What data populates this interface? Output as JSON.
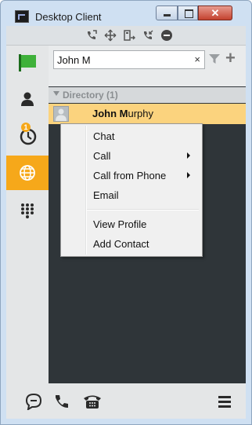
{
  "window": {
    "title": "Desktop Client"
  },
  "toolbar": {
    "icons": [
      "call-forward-icon",
      "move-icon",
      "transfer-icon",
      "call-return-icon",
      "minus-circle-icon"
    ]
  },
  "sidebar": {
    "items": [
      {
        "name": "status-flag",
        "color": "#3fb13a"
      },
      {
        "name": "contacts"
      },
      {
        "name": "history",
        "badge": "1"
      },
      {
        "name": "directory",
        "active": true
      },
      {
        "name": "dialpad"
      }
    ]
  },
  "search": {
    "value": "John M",
    "clear": "×"
  },
  "directory": {
    "label": "Directory (1)"
  },
  "contact": {
    "match": "John M",
    "rest": "urphy"
  },
  "context_menu": {
    "items": [
      {
        "label": "Chat"
      },
      {
        "label": "Call",
        "submenu": true
      },
      {
        "label": "Call from Phone",
        "submenu": true
      },
      {
        "label": "Email"
      },
      {
        "label": "View Profile"
      },
      {
        "label": "Add Contact"
      }
    ]
  },
  "colors": {
    "accent": "#f6a81a",
    "highlight_row": "#fbd37e",
    "dark_bg": "#2f3539"
  }
}
